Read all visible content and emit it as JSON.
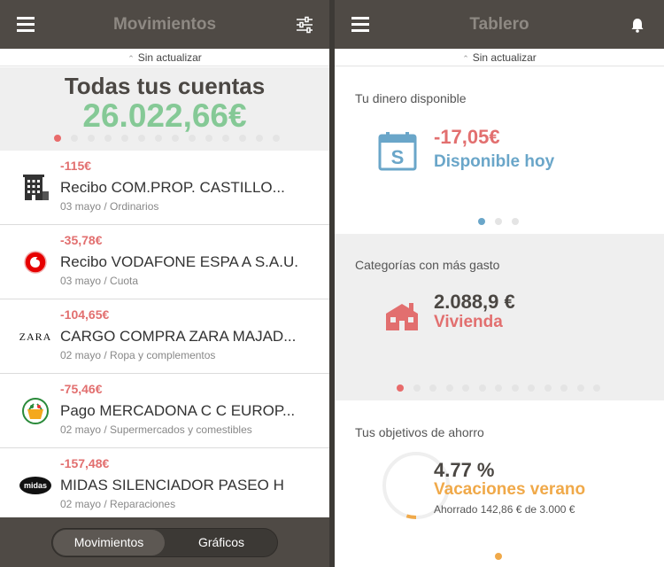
{
  "left": {
    "header": {
      "title": "Movimientos",
      "menu_icon": "hamburger-icon",
      "filter_icon": "sliders-icon"
    },
    "update_status": "Sin actualizar",
    "summary": {
      "label": "Todas tus cuentas",
      "total": "26.022,66€",
      "page_count": 14,
      "active_page": 0
    },
    "transactions": [
      {
        "amount": "-115€",
        "description": "Recibo COM.PROP. CASTILLO...",
        "meta": "03 mayo / Ordinarios",
        "icon": "building-icon"
      },
      {
        "amount": "-35,78€",
        "description": "Recibo VODAFONE ESPA A S.A.U.",
        "meta": "03 mayo / Cuota",
        "icon": "vodafone-logo"
      },
      {
        "amount": "-104,65€",
        "description": "CARGO COMPRA ZARA MAJAD...",
        "meta": "02 mayo / Ropa y complementos",
        "icon": "zara-logo",
        "logo_text": "ZARA"
      },
      {
        "amount": "-75,46€",
        "description": "Pago MERCADONA C C EUROP...",
        "meta": "02 mayo / Supermercados y comestibles",
        "icon": "mercadona-logo"
      },
      {
        "amount": "-157,48€",
        "description": "MIDAS SILENCIADOR PASEO H",
        "meta": "02 mayo / Reparaciones",
        "icon": "midas-logo",
        "logo_text": "midas"
      }
    ],
    "tabs": {
      "movimientos": "Movimientos",
      "graficos": "Gráficos",
      "selected": "Movimientos"
    }
  },
  "right": {
    "header": {
      "title": "Tablero",
      "menu_icon": "hamburger-icon",
      "bell_icon": "bell-icon"
    },
    "update_status": "Sin actualizar",
    "available": {
      "title": "Tu dinero disponible",
      "value": "-17,05€",
      "label": "Disponible hoy",
      "icon": "calendar-dollar-icon",
      "page_count": 3,
      "active_page": 0
    },
    "categories": {
      "title": "Categorías con más gasto",
      "value": "2.088,9 €",
      "label": "Vivienda",
      "icon": "house-icon",
      "page_count": 13,
      "active_page": 0
    },
    "savings": {
      "title": "Tus objetivos de ahorro",
      "percent_text": "4.77 %",
      "goal": "Vacaciones verano",
      "detail": "Ahorrado 142,86 € de 3.000 €",
      "progress": 0.0477
    }
  },
  "colors": {
    "navbar": "#4f4a45",
    "green": "#85c996",
    "red": "#e26f6f",
    "blue": "#6aa6c9",
    "orange": "#f0a949"
  }
}
